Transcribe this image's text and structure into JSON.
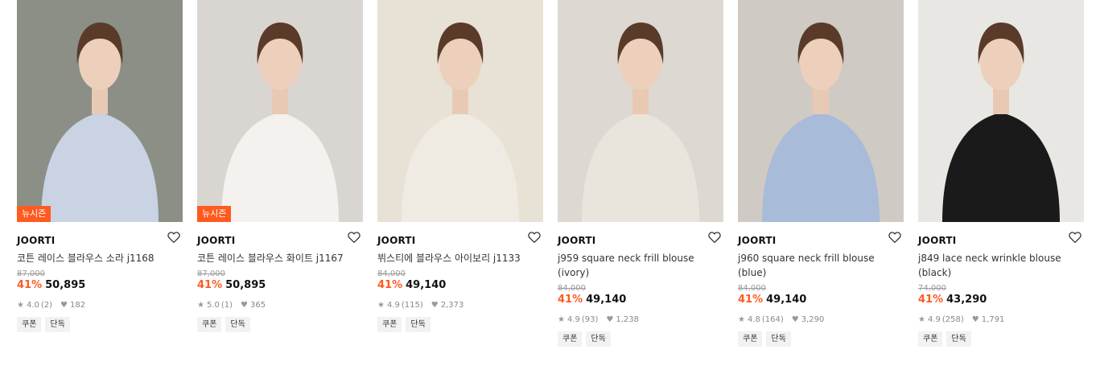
{
  "products": [
    {
      "badge": "뉴시즌",
      "brand": "JOORTI",
      "name": "코튼 레이스 블라우스 소라 j1168",
      "original_price": "87,000",
      "discount": "41%",
      "price": "50,895",
      "rating": "4.0",
      "reviews": "(2)",
      "likes": "182",
      "tags": [
        "쿠폰",
        "단독"
      ],
      "colors": {
        "bg": "#8b8f86",
        "top": "#c9d3e3"
      }
    },
    {
      "badge": "뉴시즌",
      "brand": "JOORTI",
      "name": "코튼 레이스 블라우스 화이트 j1167",
      "original_price": "87,000",
      "discount": "41%",
      "price": "50,895",
      "rating": "5.0",
      "reviews": "(1)",
      "likes": "365",
      "tags": [
        "쿠폰",
        "단독"
      ],
      "colors": {
        "bg": "#d9d6d2",
        "top": "#f4f1ee"
      }
    },
    {
      "badge": "",
      "brand": "JOORTI",
      "name": "뷔스티에 블라우스 아이보리 j1133",
      "original_price": "84,000",
      "discount": "41%",
      "price": "49,140",
      "rating": "4.9",
      "reviews": "(115)",
      "likes": "2,373",
      "tags": [
        "쿠폰",
        "단독"
      ],
      "colors": {
        "bg": "#e8e1d6",
        "top": "#f0ebe2"
      }
    },
    {
      "badge": "",
      "brand": "JOORTI",
      "name": "j959 square neck frill blouse (ivory)",
      "original_price": "84,000",
      "discount": "41%",
      "price": "49,140",
      "rating": "4.9",
      "reviews": "(93)",
      "likes": "1,238",
      "tags": [
        "쿠폰",
        "단독"
      ],
      "colors": {
        "bg": "#ddd8d2",
        "top": "#eae5dc"
      }
    },
    {
      "badge": "",
      "brand": "JOORTI",
      "name": "j960 square neck frill blouse (blue)",
      "original_price": "84,000",
      "discount": "41%",
      "price": "49,140",
      "rating": "4.8",
      "reviews": "(164)",
      "likes": "3,290",
      "tags": [
        "쿠폰",
        "단독"
      ],
      "colors": {
        "bg": "#cfcac4",
        "top": "#a8bbd8"
      }
    },
    {
      "badge": "",
      "brand": "JOORTI",
      "name": "j849 lace neck wrinkle blouse (black)",
      "original_price": "74,000",
      "discount": "41%",
      "price": "43,290",
      "rating": "4.9",
      "reviews": "(258)",
      "likes": "1,791",
      "tags": [
        "쿠폰",
        "단독"
      ],
      "colors": {
        "bg": "#e9e7e3",
        "top": "#1a1a1a"
      }
    }
  ],
  "icons": {
    "heart": "heart-outline-icon",
    "star": "star-icon",
    "like": "heart-filled-icon"
  },
  "accent": "#ff5a1f"
}
